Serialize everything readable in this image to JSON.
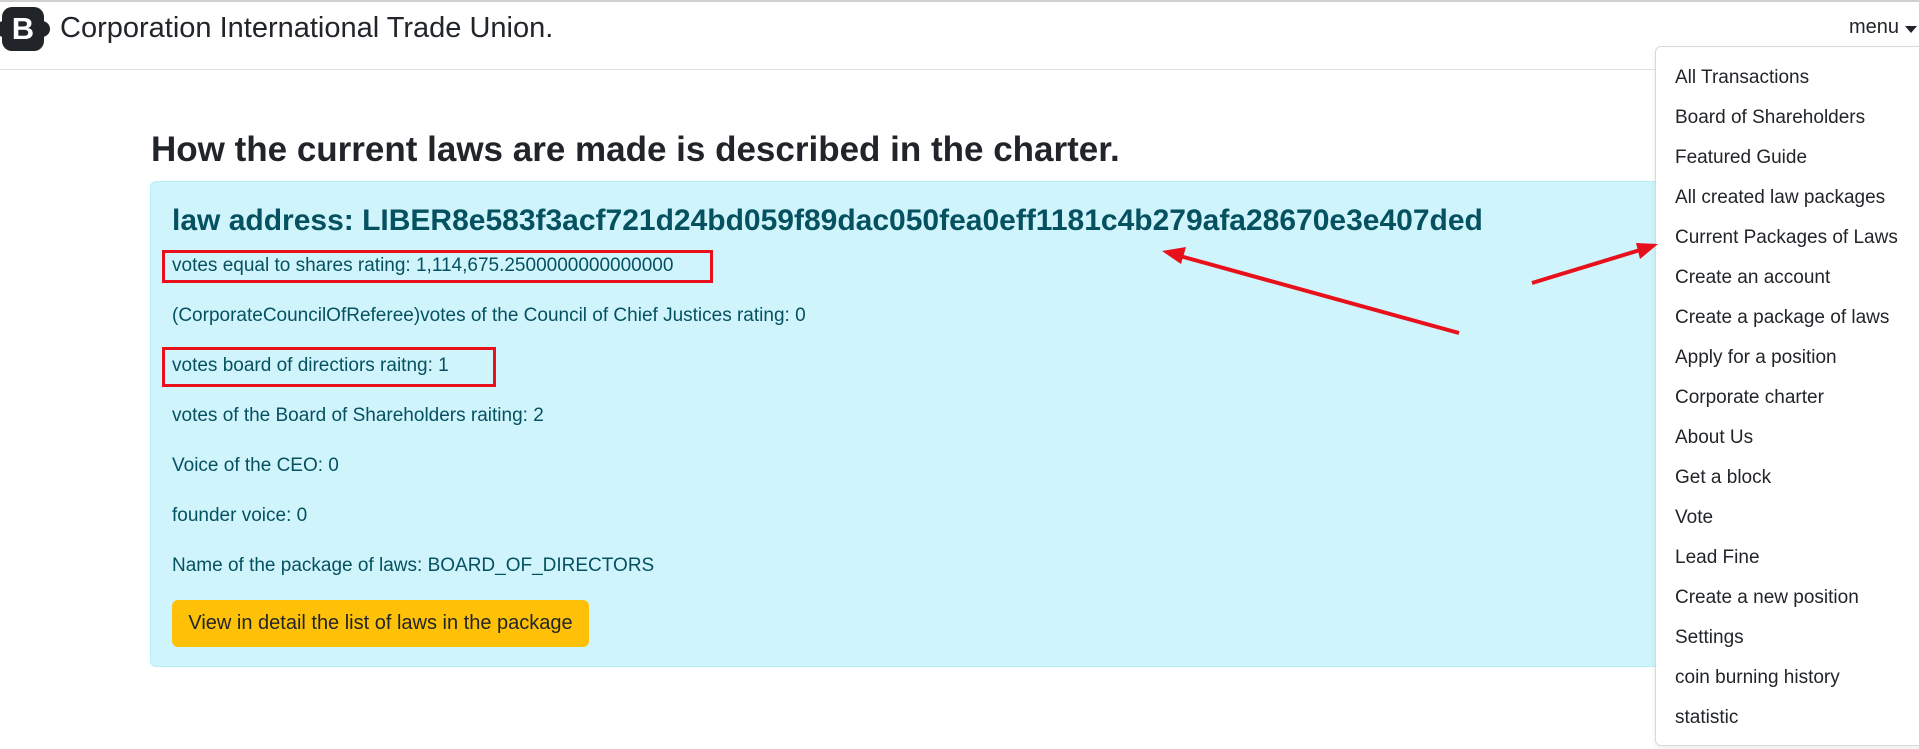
{
  "navbar": {
    "logo_letter": "B",
    "brand": "Corporation International Trade Union.",
    "menu_label": "menu"
  },
  "main": {
    "heading": "How the current laws are made is described in the charter.",
    "card": {
      "law_address": "law address: LIBER8e583f3acf721d24bd059f89dac050fea0eff1181c4b279afa28670e3e407ded",
      "lines": [
        "votes equal to shares rating: 1,114,675.2500000000000000",
        "(CorporateCouncilOfReferee)votes of the Council of Chief Justices rating: 0",
        "votes board of directiors raitng: 1",
        "votes of the Board of Shareholders raiting: 2",
        "Voice of the CEO: 0",
        "founder voice: 0",
        "Name of the package of laws: BOARD_OF_DIRECTORS"
      ],
      "button_label": "View in detail the list of laws in the package"
    }
  },
  "menu": {
    "items": [
      "All Transactions",
      "Board of Shareholders",
      "Featured Guide",
      "All created law packages",
      "Current Packages of Laws",
      "Create an account",
      "Create a package of laws",
      "Apply for a position",
      "Corporate charter",
      "About Us",
      "Get a block",
      "Vote",
      "Lead Fine",
      "Create a new position",
      "Settings",
      "coin burning history",
      "statistic"
    ]
  },
  "annotations": {
    "color": "#e8101a"
  }
}
